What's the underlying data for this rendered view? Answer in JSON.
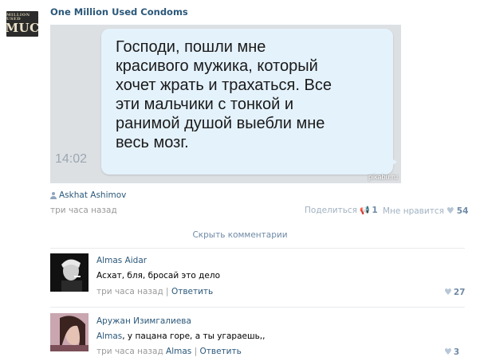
{
  "group": {
    "logo_small": "MILLION USED",
    "logo_big": "MUC",
    "title": "One Million Used Condoms"
  },
  "post": {
    "image_text": "Господи, пошли мне\nкрасивого мужика, который\nхочет жрать и трахаться. Все\nэти мальчики с тонкой и\nранимой душой выебли мне\nвесь мозг.",
    "image_time": "14:02",
    "watermark": "pikabu.ru",
    "author": "Askhat Ashimov",
    "time": "три часа назад",
    "share_label": "Поделиться",
    "share_count": "1",
    "like_label": "Мне нравится",
    "like_count": "54",
    "hide_comments": "Скрыть комментарии"
  },
  "comments": [
    {
      "name": "Almas Aidar",
      "text": "Асхат, бля, бросай это дело",
      "time": "три часа назад",
      "reply": "Ответить",
      "likes": "27"
    },
    {
      "name": "Аружан Изимгалиева",
      "mention": "Almas",
      "text": ", у пацана горе, а ты угараешь,,",
      "time": "три часа назад",
      "reply_to": "Almas",
      "reply": "Ответить",
      "likes": "3"
    }
  ],
  "colors": {
    "link": "#2b587a",
    "muted": "#999999",
    "bubble": "#e4f2fc"
  }
}
